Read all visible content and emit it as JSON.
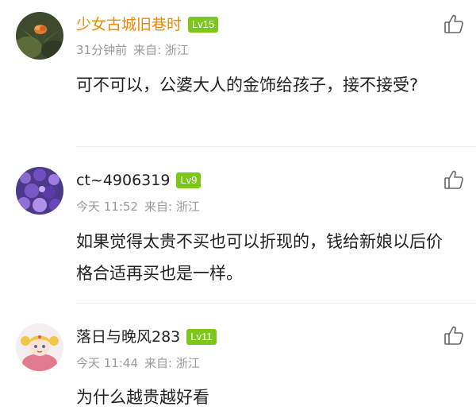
{
  "comments": [
    {
      "username": "少女古城旧巷时",
      "level": "Lv15",
      "time": "31分钟前",
      "location": "来自: 浙江",
      "content": "可不可以，公婆大人的金饰给孩子，接不接受?",
      "avatar_icon": "flower-photo-avatar",
      "name_color": "#e8890c"
    },
    {
      "username": "ct~4906319",
      "level": "Lv9",
      "time": "今天 11:52",
      "location": "来自: 浙江",
      "content": "如果觉得太贵不买也可以折现的，钱给新娘以后价格合适再买也是一样。",
      "avatar_icon": "purple-flowers-avatar",
      "name_color": "#222222"
    },
    {
      "username": "落日与晚风283",
      "level": "Lv11",
      "time": "今天 11:44",
      "location": "来自: 浙江",
      "content": "为什么越贵越好看",
      "avatar_icon": "anime-girl-avatar",
      "name_color": "#222222"
    }
  ],
  "icons": {
    "like": "thumbs-up-icon"
  },
  "colors": {
    "level_badge": "#7cc81a",
    "meta_text": "#9a9a9a",
    "divider": "#ececec"
  }
}
